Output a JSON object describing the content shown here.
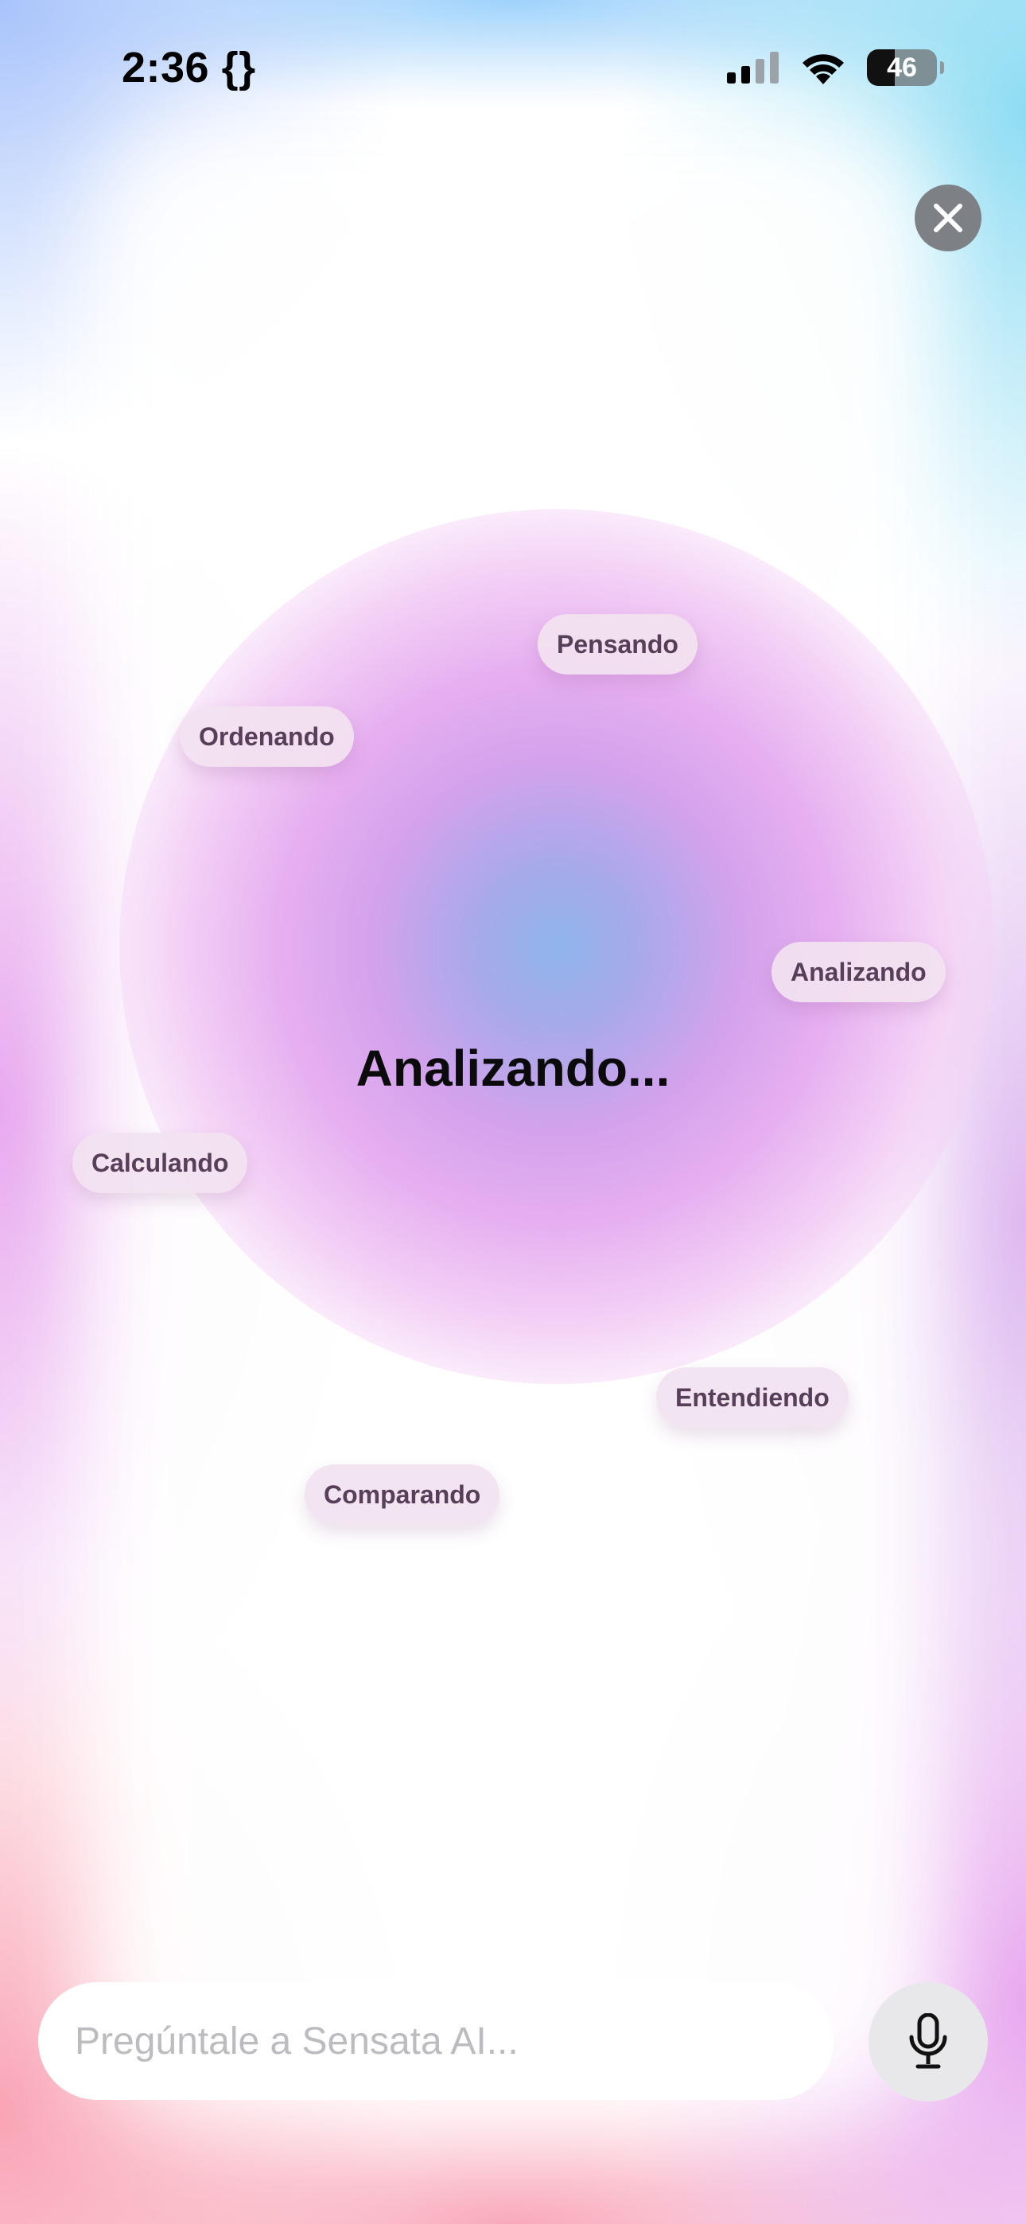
{
  "status_bar": {
    "time": "2:36 {}",
    "battery": "46",
    "signal_icon": "cellular-signal-icon",
    "wifi_icon": "wifi-icon"
  },
  "close_icon": "close-icon",
  "status_text": "Analizando...",
  "thinking_words": [
    "Pensando",
    "Ordenando",
    "Analizando",
    "Calculando",
    "Entendiendo",
    "Comparando"
  ],
  "input": {
    "placeholder": "Pregúntale a Sensata AI...",
    "value": ""
  },
  "mic_icon": "microphone-icon",
  "colors": {
    "orb_center": "#8fb5ec",
    "orb_mid": "#d4a2ec",
    "chip_text": "#573e59",
    "close_button": "#7d8186"
  }
}
